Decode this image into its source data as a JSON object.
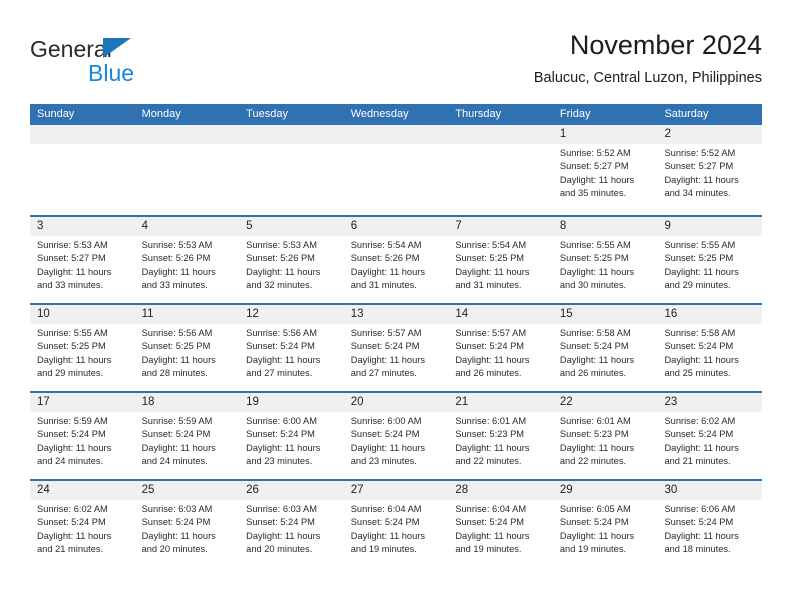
{
  "logo": {
    "word_dark": "General",
    "word_blue": "Blue",
    "triangle_color": "#1b76bc",
    "blue_text_color": "#1b86d4"
  },
  "header": {
    "title": "November 2024",
    "subtitle": "Balucuc, Central Luzon, Philippines"
  },
  "theme": {
    "header_blue": "#3071b2",
    "day_strip_gray": "#f0f0f0",
    "text_color": "#2a2a2a"
  },
  "weekdays": [
    "Sunday",
    "Monday",
    "Tuesday",
    "Wednesday",
    "Thursday",
    "Friday",
    "Saturday"
  ],
  "weeks": [
    [
      {
        "day": "",
        "sunrise": "",
        "sunset": "",
        "daylight_line1": "",
        "daylight_line2": ""
      },
      {
        "day": "",
        "sunrise": "",
        "sunset": "",
        "daylight_line1": "",
        "daylight_line2": ""
      },
      {
        "day": "",
        "sunrise": "",
        "sunset": "",
        "daylight_line1": "",
        "daylight_line2": ""
      },
      {
        "day": "",
        "sunrise": "",
        "sunset": "",
        "daylight_line1": "",
        "daylight_line2": ""
      },
      {
        "day": "",
        "sunrise": "",
        "sunset": "",
        "daylight_line1": "",
        "daylight_line2": ""
      },
      {
        "day": "1",
        "sunrise": "Sunrise: 5:52 AM",
        "sunset": "Sunset: 5:27 PM",
        "daylight_line1": "Daylight: 11 hours",
        "daylight_line2": "and 35 minutes."
      },
      {
        "day": "2",
        "sunrise": "Sunrise: 5:52 AM",
        "sunset": "Sunset: 5:27 PM",
        "daylight_line1": "Daylight: 11 hours",
        "daylight_line2": "and 34 minutes."
      }
    ],
    [
      {
        "day": "3",
        "sunrise": "Sunrise: 5:53 AM",
        "sunset": "Sunset: 5:27 PM",
        "daylight_line1": "Daylight: 11 hours",
        "daylight_line2": "and 33 minutes."
      },
      {
        "day": "4",
        "sunrise": "Sunrise: 5:53 AM",
        "sunset": "Sunset: 5:26 PM",
        "daylight_line1": "Daylight: 11 hours",
        "daylight_line2": "and 33 minutes."
      },
      {
        "day": "5",
        "sunrise": "Sunrise: 5:53 AM",
        "sunset": "Sunset: 5:26 PM",
        "daylight_line1": "Daylight: 11 hours",
        "daylight_line2": "and 32 minutes."
      },
      {
        "day": "6",
        "sunrise": "Sunrise: 5:54 AM",
        "sunset": "Sunset: 5:26 PM",
        "daylight_line1": "Daylight: 11 hours",
        "daylight_line2": "and 31 minutes."
      },
      {
        "day": "7",
        "sunrise": "Sunrise: 5:54 AM",
        "sunset": "Sunset: 5:25 PM",
        "daylight_line1": "Daylight: 11 hours",
        "daylight_line2": "and 31 minutes."
      },
      {
        "day": "8",
        "sunrise": "Sunrise: 5:55 AM",
        "sunset": "Sunset: 5:25 PM",
        "daylight_line1": "Daylight: 11 hours",
        "daylight_line2": "and 30 minutes."
      },
      {
        "day": "9",
        "sunrise": "Sunrise: 5:55 AM",
        "sunset": "Sunset: 5:25 PM",
        "daylight_line1": "Daylight: 11 hours",
        "daylight_line2": "and 29 minutes."
      }
    ],
    [
      {
        "day": "10",
        "sunrise": "Sunrise: 5:55 AM",
        "sunset": "Sunset: 5:25 PM",
        "daylight_line1": "Daylight: 11 hours",
        "daylight_line2": "and 29 minutes."
      },
      {
        "day": "11",
        "sunrise": "Sunrise: 5:56 AM",
        "sunset": "Sunset: 5:25 PM",
        "daylight_line1": "Daylight: 11 hours",
        "daylight_line2": "and 28 minutes."
      },
      {
        "day": "12",
        "sunrise": "Sunrise: 5:56 AM",
        "sunset": "Sunset: 5:24 PM",
        "daylight_line1": "Daylight: 11 hours",
        "daylight_line2": "and 27 minutes."
      },
      {
        "day": "13",
        "sunrise": "Sunrise: 5:57 AM",
        "sunset": "Sunset: 5:24 PM",
        "daylight_line1": "Daylight: 11 hours",
        "daylight_line2": "and 27 minutes."
      },
      {
        "day": "14",
        "sunrise": "Sunrise: 5:57 AM",
        "sunset": "Sunset: 5:24 PM",
        "daylight_line1": "Daylight: 11 hours",
        "daylight_line2": "and 26 minutes."
      },
      {
        "day": "15",
        "sunrise": "Sunrise: 5:58 AM",
        "sunset": "Sunset: 5:24 PM",
        "daylight_line1": "Daylight: 11 hours",
        "daylight_line2": "and 26 minutes."
      },
      {
        "day": "16",
        "sunrise": "Sunrise: 5:58 AM",
        "sunset": "Sunset: 5:24 PM",
        "daylight_line1": "Daylight: 11 hours",
        "daylight_line2": "and 25 minutes."
      }
    ],
    [
      {
        "day": "17",
        "sunrise": "Sunrise: 5:59 AM",
        "sunset": "Sunset: 5:24 PM",
        "daylight_line1": "Daylight: 11 hours",
        "daylight_line2": "and 24 minutes."
      },
      {
        "day": "18",
        "sunrise": "Sunrise: 5:59 AM",
        "sunset": "Sunset: 5:24 PM",
        "daylight_line1": "Daylight: 11 hours",
        "daylight_line2": "and 24 minutes."
      },
      {
        "day": "19",
        "sunrise": "Sunrise: 6:00 AM",
        "sunset": "Sunset: 5:24 PM",
        "daylight_line1": "Daylight: 11 hours",
        "daylight_line2": "and 23 minutes."
      },
      {
        "day": "20",
        "sunrise": "Sunrise: 6:00 AM",
        "sunset": "Sunset: 5:24 PM",
        "daylight_line1": "Daylight: 11 hours",
        "daylight_line2": "and 23 minutes."
      },
      {
        "day": "21",
        "sunrise": "Sunrise: 6:01 AM",
        "sunset": "Sunset: 5:23 PM",
        "daylight_line1": "Daylight: 11 hours",
        "daylight_line2": "and 22 minutes."
      },
      {
        "day": "22",
        "sunrise": "Sunrise: 6:01 AM",
        "sunset": "Sunset: 5:23 PM",
        "daylight_line1": "Daylight: 11 hours",
        "daylight_line2": "and 22 minutes."
      },
      {
        "day": "23",
        "sunrise": "Sunrise: 6:02 AM",
        "sunset": "Sunset: 5:24 PM",
        "daylight_line1": "Daylight: 11 hours",
        "daylight_line2": "and 21 minutes."
      }
    ],
    [
      {
        "day": "24",
        "sunrise": "Sunrise: 6:02 AM",
        "sunset": "Sunset: 5:24 PM",
        "daylight_line1": "Daylight: 11 hours",
        "daylight_line2": "and 21 minutes."
      },
      {
        "day": "25",
        "sunrise": "Sunrise: 6:03 AM",
        "sunset": "Sunset: 5:24 PM",
        "daylight_line1": "Daylight: 11 hours",
        "daylight_line2": "and 20 minutes."
      },
      {
        "day": "26",
        "sunrise": "Sunrise: 6:03 AM",
        "sunset": "Sunset: 5:24 PM",
        "daylight_line1": "Daylight: 11 hours",
        "daylight_line2": "and 20 minutes."
      },
      {
        "day": "27",
        "sunrise": "Sunrise: 6:04 AM",
        "sunset": "Sunset: 5:24 PM",
        "daylight_line1": "Daylight: 11 hours",
        "daylight_line2": "and 19 minutes."
      },
      {
        "day": "28",
        "sunrise": "Sunrise: 6:04 AM",
        "sunset": "Sunset: 5:24 PM",
        "daylight_line1": "Daylight: 11 hours",
        "daylight_line2": "and 19 minutes."
      },
      {
        "day": "29",
        "sunrise": "Sunrise: 6:05 AM",
        "sunset": "Sunset: 5:24 PM",
        "daylight_line1": "Daylight: 11 hours",
        "daylight_line2": "and 19 minutes."
      },
      {
        "day": "30",
        "sunrise": "Sunrise: 6:06 AM",
        "sunset": "Sunset: 5:24 PM",
        "daylight_line1": "Daylight: 11 hours",
        "daylight_line2": "and 18 minutes."
      }
    ]
  ]
}
